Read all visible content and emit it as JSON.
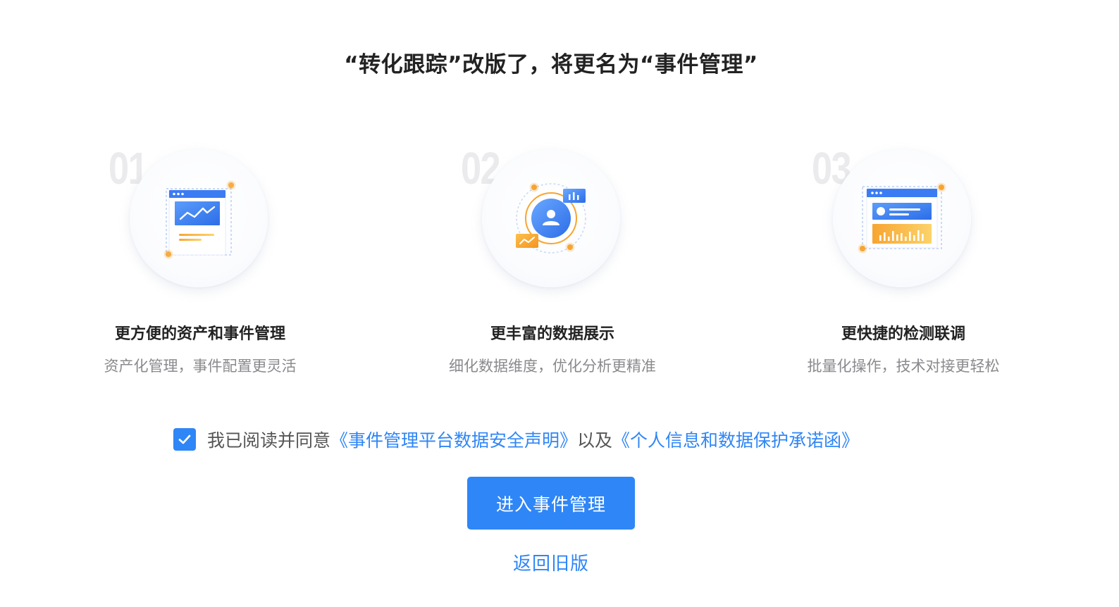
{
  "title": "“转化跟踪”改版了，将更名为“事件管理”",
  "features": [
    {
      "number": "01",
      "title": "更方便的资产和事件管理",
      "subtitle": "资产化管理，事件配置更灵活",
      "icon": "asset-window-chart-icon"
    },
    {
      "number": "02",
      "title": "更丰富的数据展示",
      "subtitle": "细化数据维度，优化分析更精准",
      "icon": "user-data-orbit-icon"
    },
    {
      "number": "03",
      "title": "更快捷的检测联调",
      "subtitle": "批量化操作，技术对接更轻松",
      "icon": "profile-bar-chart-window-icon"
    }
  ],
  "agreement": {
    "checked": true,
    "prefix": "我已阅读并同意",
    "link1": "《事件管理平台数据安全声明》",
    "middle": "以及",
    "link2": "《个人信息和数据保护承诺函》"
  },
  "enter_button": "进入事件管理",
  "back_link": "返回旧版",
  "colors": {
    "primary": "#2f86f6",
    "orange": "#f7a531",
    "title": "#222222",
    "subtext": "#8a8a8e",
    "number": "#ebebed"
  }
}
